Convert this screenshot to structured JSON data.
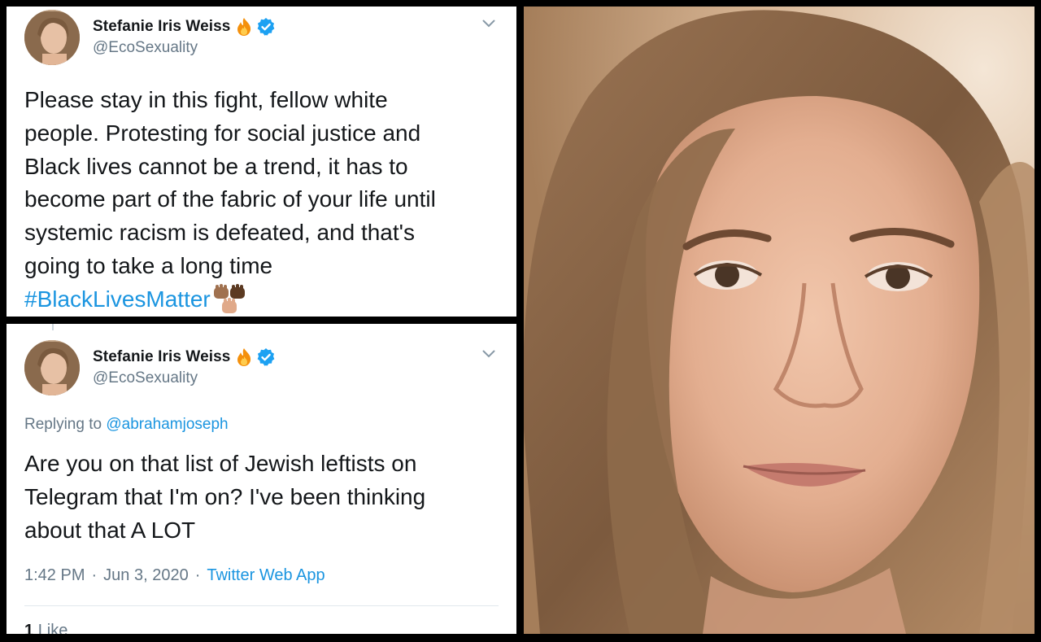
{
  "tweet_top": {
    "display_name": "Stefanie Iris Weiss",
    "handle": "@EcoSexuality",
    "body_lines": [
      "Please stay in this fight, fellow white",
      "people. Protesting for social justice and",
      "Black lives cannot be a trend, it has to",
      "become part of the fabric of your life until",
      "systemic racism is defeated, and that's",
      "going to take a long time"
    ],
    "hashtag": "#BlackLivesMatter"
  },
  "tweet_bottom": {
    "display_name": "Stefanie Iris Weiss",
    "handle": "@EcoSexuality",
    "replying_prefix": "Replying to",
    "replying_to": "@abrahamjoseph",
    "body_lines": [
      "Are you on that list of Jewish leftists on",
      "Telegram that I'm on? I've been thinking",
      "about that A LOT"
    ],
    "time": "1:42 PM",
    "sep1": "·",
    "date": "Jun 3, 2020",
    "sep2": "·",
    "source": "Twitter Web App",
    "likes_count": "1",
    "likes_label": "Like"
  },
  "icons": {
    "fire": "fire-emoji-icon",
    "verified": "verified-badge-icon",
    "caret": "chevron-down-icon",
    "fists": "raised-fists-emoji-icon"
  },
  "colors": {
    "link": "#1b95e0",
    "muted": "#657786",
    "text": "#14171a",
    "verified": "#1da1f2"
  }
}
